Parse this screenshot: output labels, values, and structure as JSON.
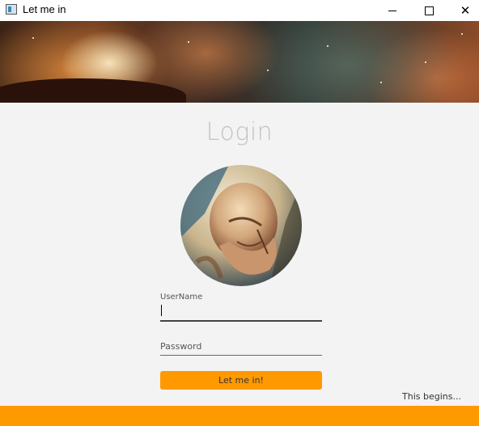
{
  "window": {
    "title": "Let me in"
  },
  "titlebar": {
    "icons": {
      "app": "app-window-icon",
      "minimize": "minimize-icon",
      "maximize": "maximize-icon",
      "close": "close-icon"
    },
    "close_glyph": "✕"
  },
  "login": {
    "heading": "Login",
    "username_label": "UserName",
    "username_value": "",
    "password_placeholder": "Password",
    "submit_label": "Let me in!"
  },
  "footer": {
    "tagline": "This begins..."
  },
  "colors": {
    "accent": "#ff9900",
    "heading": "#c2c2c2",
    "background": "#f3f3f3"
  }
}
